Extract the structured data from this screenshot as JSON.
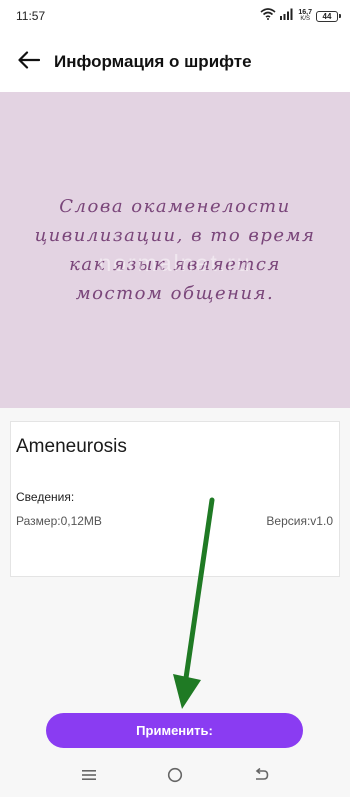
{
  "status_bar": {
    "time": "11:57",
    "net_speed_value": "16,7",
    "net_speed_unit": "K/S",
    "battery": "44"
  },
  "header": {
    "title": "Информация о шрифте"
  },
  "preview": {
    "text": "Слова окаменелости цивилизации, в то время как язык является мостом общения."
  },
  "font_info": {
    "name": "Ameneurosis",
    "details_label": "Сведения:",
    "size_text": "Размер:0,12MB",
    "version_text": "Версия:v1.0"
  },
  "watermark": "normalnet.ru",
  "apply_button": {
    "label": "Применить:"
  },
  "colors": {
    "accent": "#8a3cf2",
    "preview_bg": "#e3d3e2",
    "preview_text": "#7a467a",
    "annotation_arrow": "#1f7a24"
  },
  "icons": {
    "back": "arrow-left-icon",
    "nav_menu": "menu-icon",
    "nav_home": "home-circle-icon",
    "nav_back": "return-icon"
  }
}
